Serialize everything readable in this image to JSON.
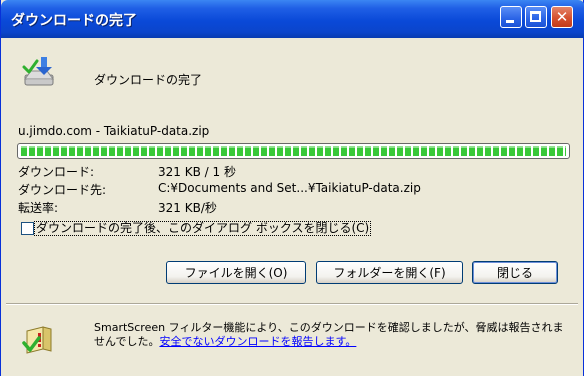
{
  "window": {
    "title": "ダウンロードの完了",
    "close_glyph": "✕"
  },
  "header": {
    "title": "ダウンロードの完了"
  },
  "download": {
    "source": "u.jimdo.com - TaikiatuP-data.zip",
    "progress_fraction": 1.0,
    "rows": [
      {
        "label": "ダウンロード:",
        "value": "321 KB / 1 秒"
      },
      {
        "label": "ダウンロード先:",
        "value": "C:¥Documents and Set...¥TaikiatuP-data.zip"
      },
      {
        "label": "転送率:",
        "value": "321 KB/秒"
      }
    ]
  },
  "option": {
    "close_after_label": "ダウンロードの完了後、このダイアログ ボックスを閉じる(C)",
    "checked": false
  },
  "buttons": {
    "open_file": "ファイルを開く(O)",
    "open_folder": "フォルダーを開く(F)",
    "close": "閉じる"
  },
  "smartscreen": {
    "text_before": "SmartScreen フィルター機能により、このダウンロードを確認しましたが、脅威は報告されませんでした。",
    "link": "安全でないダウンロードを報告します。"
  },
  "icons": {
    "download": "download-complete-icon",
    "shield": "smartscreen-shield-icon"
  },
  "colors": {
    "title_bar": "#0a49d8",
    "progress": "#38c838",
    "link": "#0000ff",
    "dialog_bg": "#ece9d8"
  }
}
